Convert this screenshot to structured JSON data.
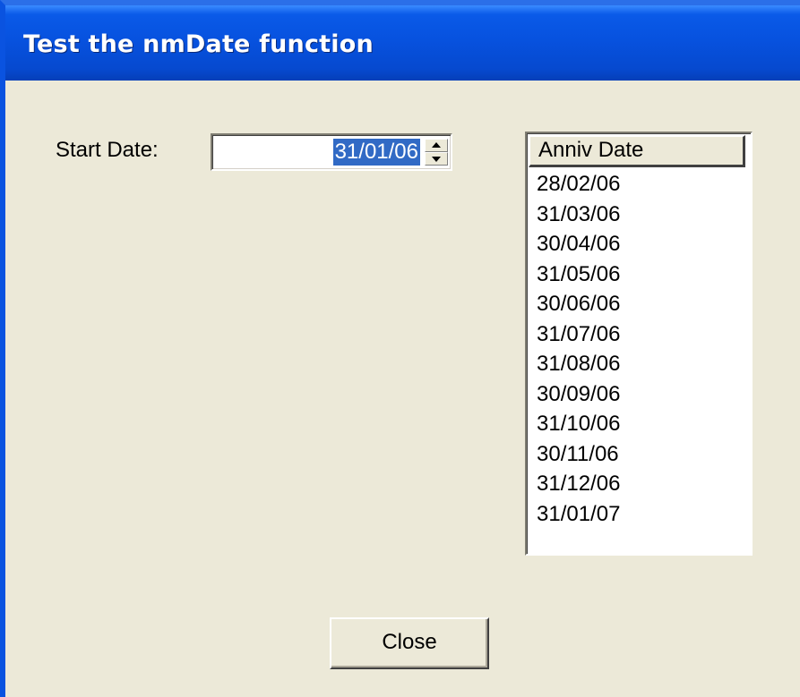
{
  "window": {
    "title": "Test the nmDate function"
  },
  "form": {
    "start_date_label": "Start Date:",
    "start_date_value": "31/01/06"
  },
  "list": {
    "column_header": "Anniv Date",
    "items": [
      "28/02/06",
      "31/03/06",
      "30/04/06",
      "31/05/06",
      "30/06/06",
      "31/07/06",
      "31/08/06",
      "30/09/06",
      "31/10/06",
      "30/11/06",
      "31/12/06",
      "31/01/07"
    ]
  },
  "buttons": {
    "close_label": "Close"
  },
  "icons": {
    "spin_up": "chevron-up-icon",
    "spin_down": "chevron-down-icon"
  },
  "colors": {
    "titlebar": "#0752df",
    "selection": "#316ac5",
    "face": "#ece9d8"
  }
}
